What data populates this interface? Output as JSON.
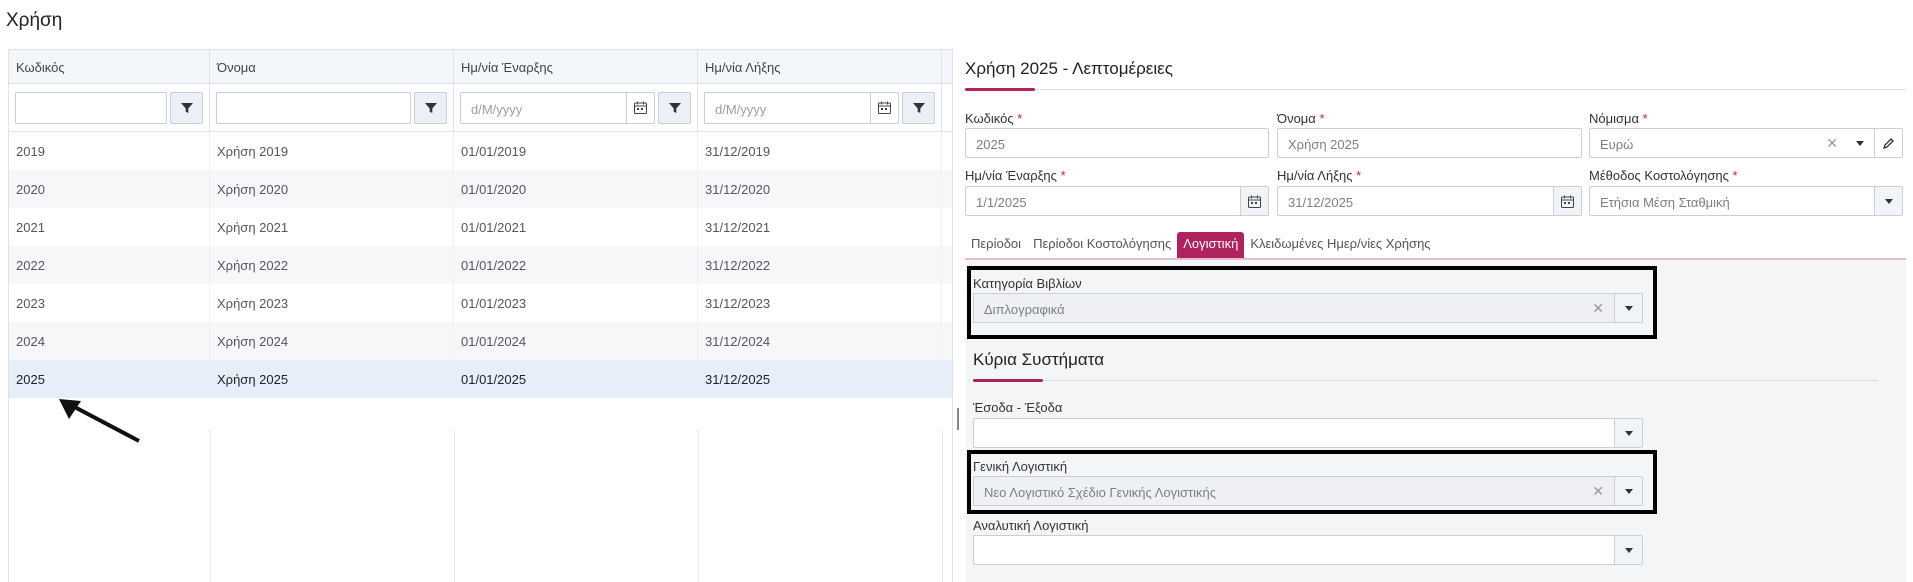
{
  "page": {
    "title": "Χρήση"
  },
  "grid": {
    "columns": [
      "Κωδικός",
      "Όνομα",
      "Ημ/νία Έναρξης",
      "Ημ/νία Λήξης"
    ],
    "filters": {
      "start_placeholder": "d/M/yyyy",
      "end_placeholder": "d/M/yyyy"
    },
    "rows": [
      [
        "2019",
        "Χρήση 2019",
        "01/01/2019",
        "31/12/2019"
      ],
      [
        "2020",
        "Χρήση 2020",
        "01/01/2020",
        "31/12/2020"
      ],
      [
        "2021",
        "Χρήση 2021",
        "01/01/2021",
        "31/12/2021"
      ],
      [
        "2022",
        "Χρήση 2022",
        "01/01/2022",
        "31/12/2022"
      ],
      [
        "2023",
        "Χρήση 2023",
        "01/01/2023",
        "31/12/2023"
      ],
      [
        "2024",
        "Χρήση 2024",
        "01/01/2024",
        "31/12/2024"
      ],
      [
        "2025",
        "Χρήση 2025",
        "01/01/2025",
        "31/12/2025"
      ]
    ],
    "selected_index": 6
  },
  "detail": {
    "title": "Χρήση 2025 - Λεπτομέρειες",
    "code": {
      "label": "Κωδικός",
      "value": "2025"
    },
    "name": {
      "label": "Όνομα",
      "value": "Χρήση 2025"
    },
    "currency": {
      "label": "Νόμισμα",
      "value": "Ευρώ"
    },
    "start": {
      "label": "Ημ/νία Έναρξης",
      "value": "1/1/2025"
    },
    "end": {
      "label": "Ημ/νία Λήξης",
      "value": "31/12/2025"
    },
    "costing": {
      "label": "Μέθοδος Κοστολόγησης",
      "value": "Ετήσια Μέση Σταθμική"
    },
    "required_mark": "*",
    "tabs": [
      "Περίοδοι",
      "Περίοδοι Κοστολόγησης",
      "Λογιστική",
      "Κλειδωμένες Ημερ/νίες Χρήσης"
    ],
    "active_tab": 2
  },
  "accounting": {
    "books_category": {
      "label": "Κατηγορία Βιβλίων",
      "value": "Διπλογραφικά"
    },
    "section_title": "Κύρια Συστήματα",
    "income_expense": {
      "label": "Έσοδα - Έξοδα",
      "value": ""
    },
    "general": {
      "label": "Γενική Λογιστική",
      "value": "Νεο Λογιστικό Σχέδιο Γενικής Λογιστικής"
    },
    "analytic": {
      "label": "Αναλυτική Λογιστική",
      "value": ""
    }
  },
  "icons": {
    "filter": "filter-icon",
    "calendar": "calendar-icon",
    "dropdown": "chevron-down-icon",
    "clear": "close-icon",
    "edit": "pencil-icon"
  },
  "colors": {
    "accent": "#b0235f",
    "selected_row": "#e6eefa",
    "header_bg": "#f3f7fb"
  }
}
